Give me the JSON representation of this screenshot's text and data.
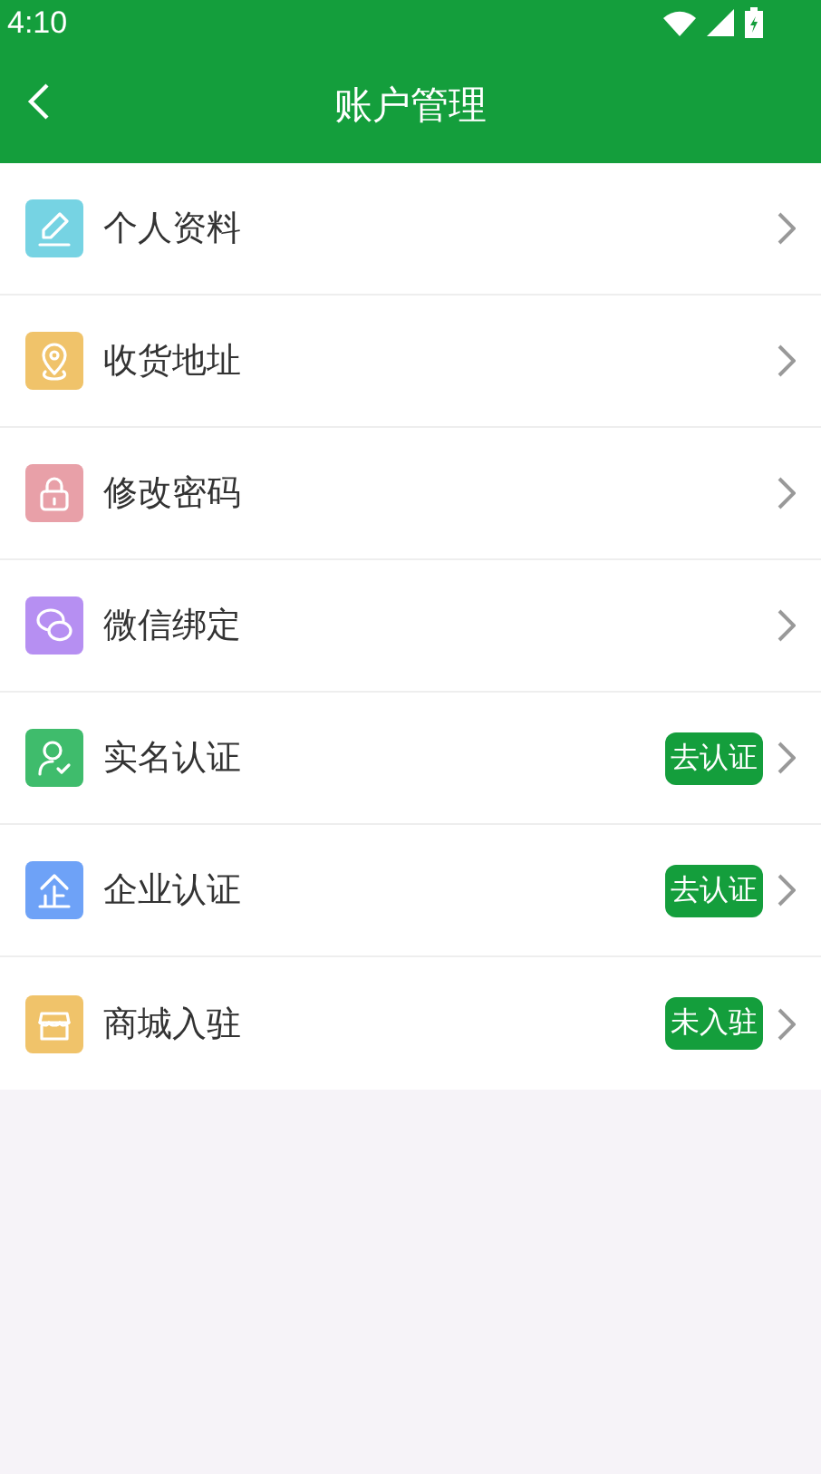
{
  "status_bar": {
    "time": "4:10"
  },
  "app_bar": {
    "title": "账户管理"
  },
  "items": [
    {
      "label": "个人资料",
      "color": "#76d3e3"
    },
    {
      "label": "收货地址",
      "color": "#f0c36a"
    },
    {
      "label": "修改密码",
      "color": "#e8a0a8"
    },
    {
      "label": "微信绑定",
      "color": "#b68ff2"
    },
    {
      "label": "实名认证",
      "color": "#3fbc6c",
      "badge": "去认证"
    },
    {
      "label": "企业认证",
      "color": "#6ea2f7",
      "badge": "去认证"
    },
    {
      "label": "商城入驻",
      "color": "#f0c36a",
      "badge": "未入驻"
    }
  ]
}
